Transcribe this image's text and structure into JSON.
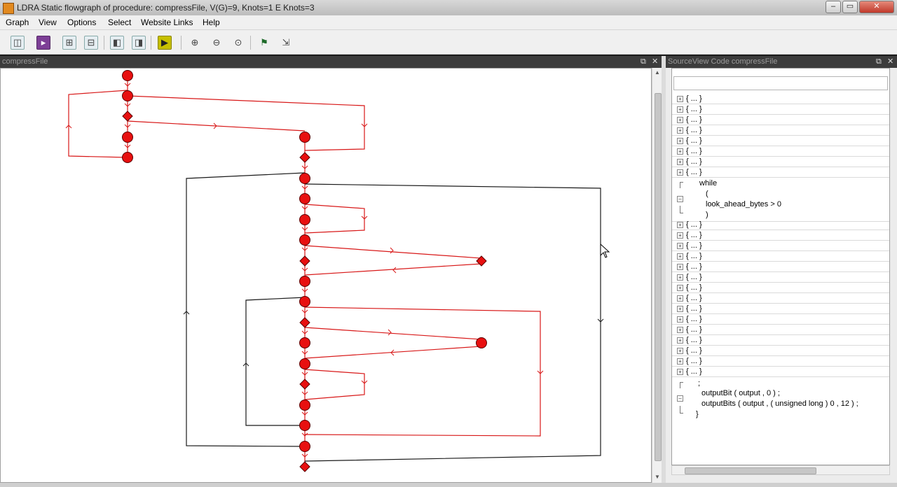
{
  "window": {
    "title": "LDRA Static flowgraph of procedure: compressFile, V(G)=9, Knots=1 E Knots=3",
    "min_label": "–",
    "max_label": "▭",
    "close_label": "✕"
  },
  "menu": {
    "items": [
      "Graph",
      "View",
      "Options",
      "Select",
      "Website Links",
      "Help"
    ]
  },
  "toolbar": {
    "buttons": [
      "fit-icon",
      "play-icon",
      "expand-icon",
      "collapse-icon",
      "prev-icon",
      "next-icon",
      "run-icon",
      "zoom-in-icon",
      "zoom-out-icon",
      "zoom-fit-icon",
      "flag-icon",
      "export-icon"
    ]
  },
  "graph_pane": {
    "title": "compressFile",
    "restore_label": "⧉",
    "close_label": "✕"
  },
  "code_pane": {
    "title": "SourceView Code compressFile",
    "restore_label": "⧉",
    "close_label": "✕",
    "collapsed_label": "{ ... }",
    "while_block": [
      "while",
      "(",
      "look_ahead_bytes > 0",
      ")"
    ],
    "tail_block": [
      ";",
      "outputBit ( output , 0 ) ;",
      "outputBits ( output , ( unsigned long ) 0 , 12 ) ;",
      "}"
    ]
  },
  "colors": {
    "node_fill": "#e81010",
    "node_stroke": "#5a0000",
    "edge_red": "#d81818",
    "edge_dark": "#1a1a1a",
    "pane_header": "#3c3c3c"
  }
}
